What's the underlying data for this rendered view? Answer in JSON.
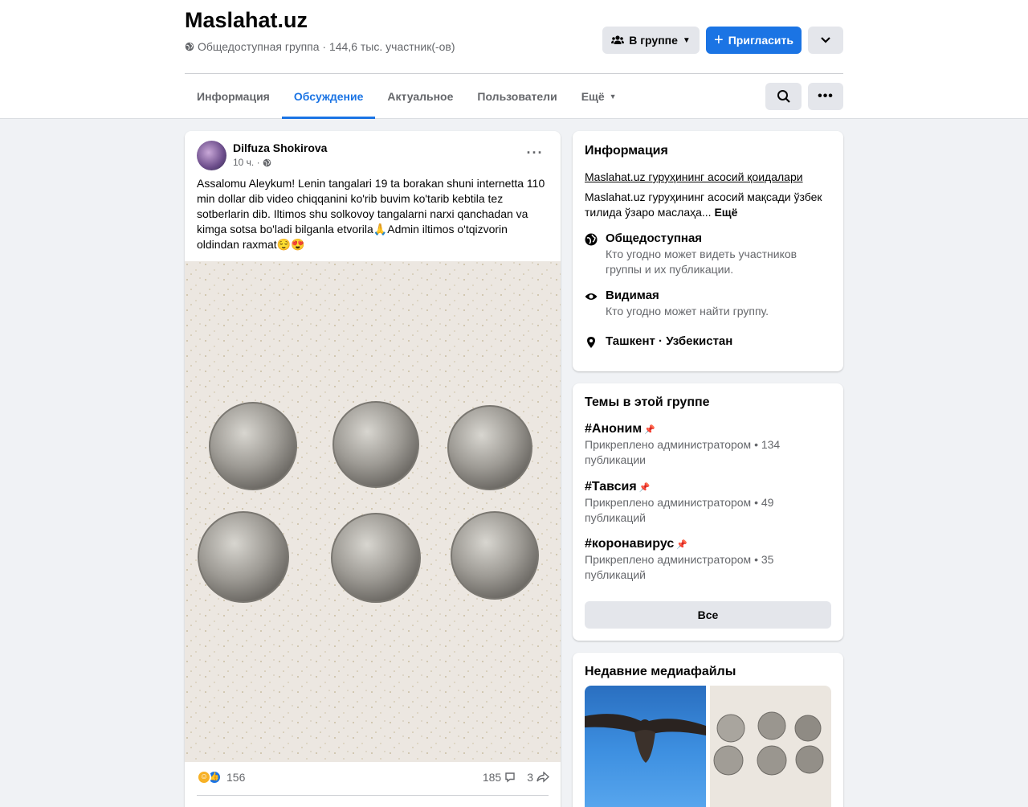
{
  "group": {
    "title": "Maslahat.uz",
    "subtitle": "Общедоступная группа · 144,6 тыс. участник(-ов)"
  },
  "actions": {
    "joined_label": "В группе",
    "invite_label": "Пригласить"
  },
  "tabs": [
    {
      "label": "Информация"
    },
    {
      "label": "Обсуждение"
    },
    {
      "label": "Актуальное"
    },
    {
      "label": "Пользователи"
    },
    {
      "label": "Ещё"
    }
  ],
  "post": {
    "author": "Dilfuza Shokirova",
    "time": "10 ч. ·",
    "text": "Assalomu Aleykum! Lenin tangalari 19 ta borakan shuni internetta 110 min dollar dib video chiqqanini ko'rib buvim ko'tarib kebtila tez sotberlarin dib. Iltimos shu solkovoy tangalarni narxi qanchadan va kimga sotsa bo'ladi bilganla etvorila🙏Admin iltimos o'tqizvorin oldindan raxmat😌😍",
    "reactions_count": "156",
    "comments_count": "185",
    "shares_count": "3"
  },
  "info": {
    "title": "Информация",
    "rules_link": "Maslahat.uz гуруҳининг асосий қоидалари",
    "description": "Maslahat.uz гуруҳининг асосий мақсади ўзбек тилида ўзаро маслаҳа...",
    "more": "Ещё",
    "privacy_title": "Общедоступная",
    "privacy_sub": "Кто угодно может видеть участников группы и их публикации.",
    "visible_title": "Видимая",
    "visible_sub": "Кто угодно может найти группу.",
    "location": "Ташкент · Узбекистан"
  },
  "topics": {
    "title": "Темы в этой группе",
    "items": [
      {
        "name": "#Аноним",
        "sub": "Прикреплено администратором • 134 публикации"
      },
      {
        "name": "#Тавсия",
        "sub": "Прикреплено администратором • 49 публикаций"
      },
      {
        "name": "#коронавирус",
        "sub": "Прикреплено администратором • 35 публикаций"
      }
    ],
    "all_label": "Все"
  },
  "media": {
    "title": "Недавние медиафайлы"
  },
  "colors": {
    "accent": "#1b74e4",
    "background": "#f0f2f5",
    "secondary_text": "#65676b"
  }
}
